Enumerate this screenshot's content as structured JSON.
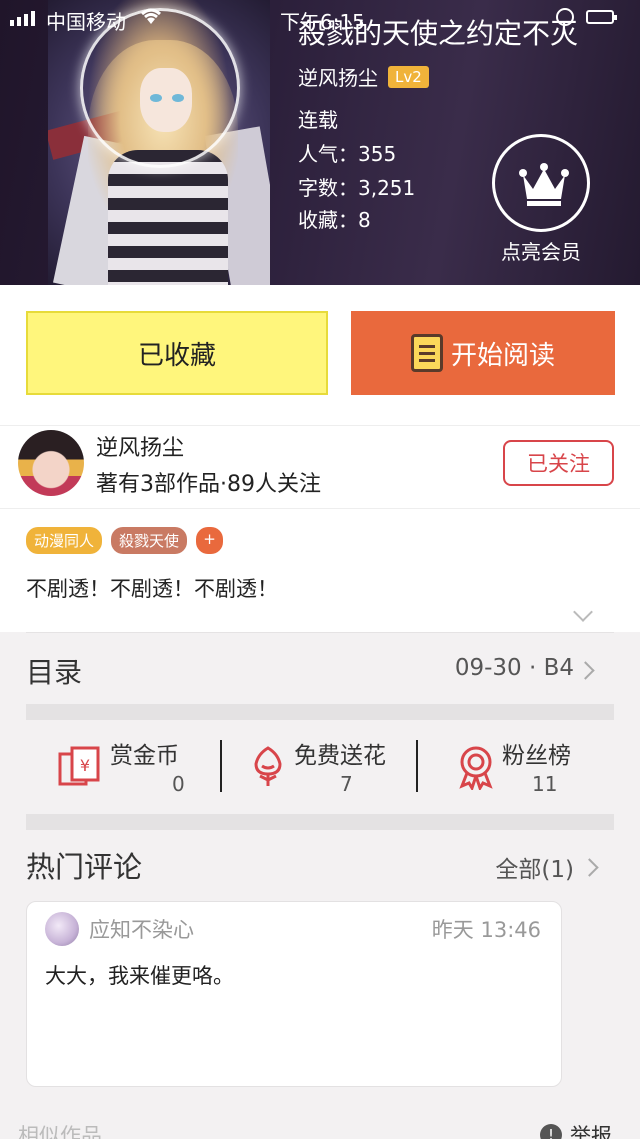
{
  "status_bar": {
    "carrier": "中国移动",
    "time": "下午6:15"
  },
  "book": {
    "title": "殺戮的天使之约定不灭",
    "author": "逆风扬尘",
    "level": "Lv2",
    "status": "连载",
    "popularity_label": "人气：",
    "popularity": "355",
    "words_label": "字数：",
    "words": "3,251",
    "favorites_label": "收藏：",
    "favorites": "8",
    "vip_label": "点亮会员",
    "vip_icon": "crown-icon"
  },
  "actions": {
    "collect_label": "已收藏",
    "read_label": "开始阅读",
    "read_icon": "book-icon"
  },
  "author_card": {
    "name": "逆风扬尘",
    "works_count_text": "著有3部作品·89人关注",
    "follow_label": "已关注"
  },
  "tags": [
    "动漫同人",
    "殺戮天使",
    "+"
  ],
  "description": "不剧透！不剧透！不剧透！",
  "catalog": {
    "label": "目录",
    "latest": "09-30 · B4"
  },
  "rewards": [
    {
      "label": "赏金币",
      "count": "0",
      "icon": "red-envelope-icon"
    },
    {
      "label": "免费送花",
      "count": "7",
      "icon": "flower-icon"
    },
    {
      "label": "粉丝榜",
      "count": "11",
      "icon": "medal-icon"
    }
  ],
  "comments": {
    "title": "热门评论",
    "all_label": "全部(1)",
    "items": [
      {
        "user": "应知不染心",
        "time": "昨天 13:46",
        "text": "大大，我来催更咯。"
      }
    ]
  },
  "footer": {
    "similar_label": "相似作品",
    "report_label": "举报"
  },
  "colors": {
    "accent_orange": "#e9693d",
    "collect_yellow": "#fff67c",
    "follow_red": "#d8454a",
    "tag_yellow": "#f0b33a",
    "tag_brown": "#c97a63"
  }
}
